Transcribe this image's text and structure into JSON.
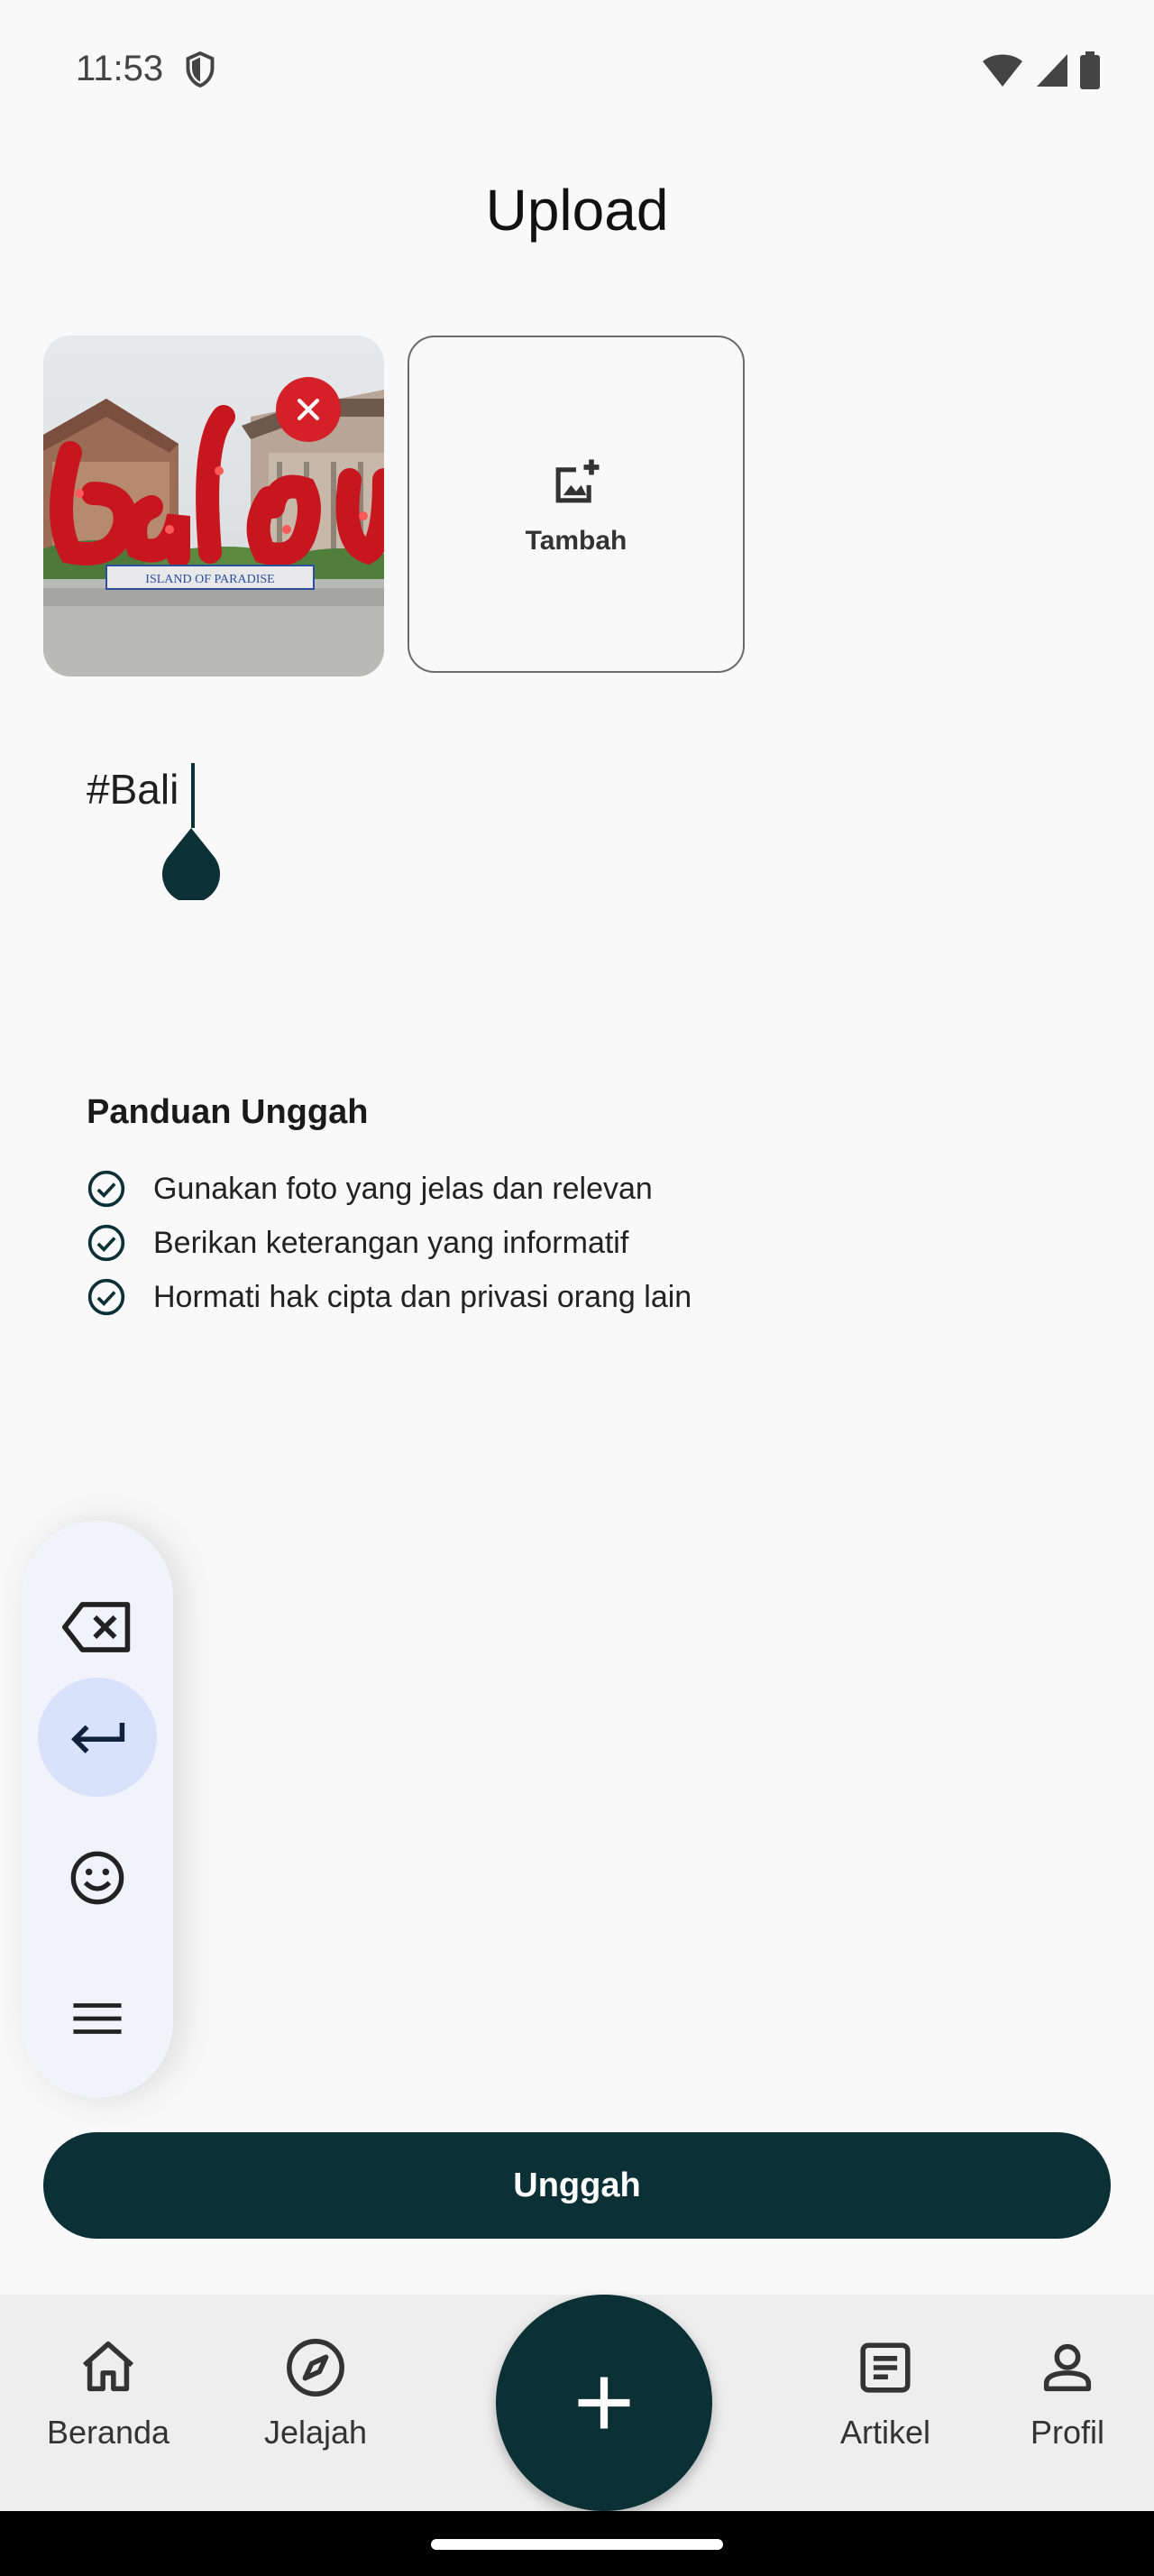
{
  "status_bar": {
    "time": "11:53"
  },
  "header": {
    "title": "Upload"
  },
  "media": {
    "thumbnail_icon": "photo-thumbnail",
    "remove_icon": "close-icon",
    "add_label": "Tambah",
    "add_icon": "add-photo-icon"
  },
  "caption": {
    "value": "#Bali"
  },
  "guidelines": {
    "title": "Panduan Unggah",
    "items": [
      "Gunakan foto yang jelas dan relevan",
      "Berikan keterangan yang informatif",
      "Hormati hak cipta dan privasi orang lain"
    ]
  },
  "keyboard_toolbar": {
    "icons": [
      "backspace-icon",
      "enter-icon",
      "emoji-icon",
      "menu-icon"
    ]
  },
  "actions": {
    "submit_label": "Unggah"
  },
  "bottom_nav": {
    "items": [
      {
        "label": "Beranda",
        "icon": "home-icon"
      },
      {
        "label": "Jelajah",
        "icon": "compass-icon"
      },
      {
        "label": "Artikel",
        "icon": "article-icon"
      },
      {
        "label": "Profil",
        "icon": "person-icon"
      }
    ],
    "fab_icon": "plus-icon"
  },
  "colors": {
    "primary": "#0b3036",
    "danger": "#d62027",
    "keyboard_active": "#d8e2fb"
  }
}
